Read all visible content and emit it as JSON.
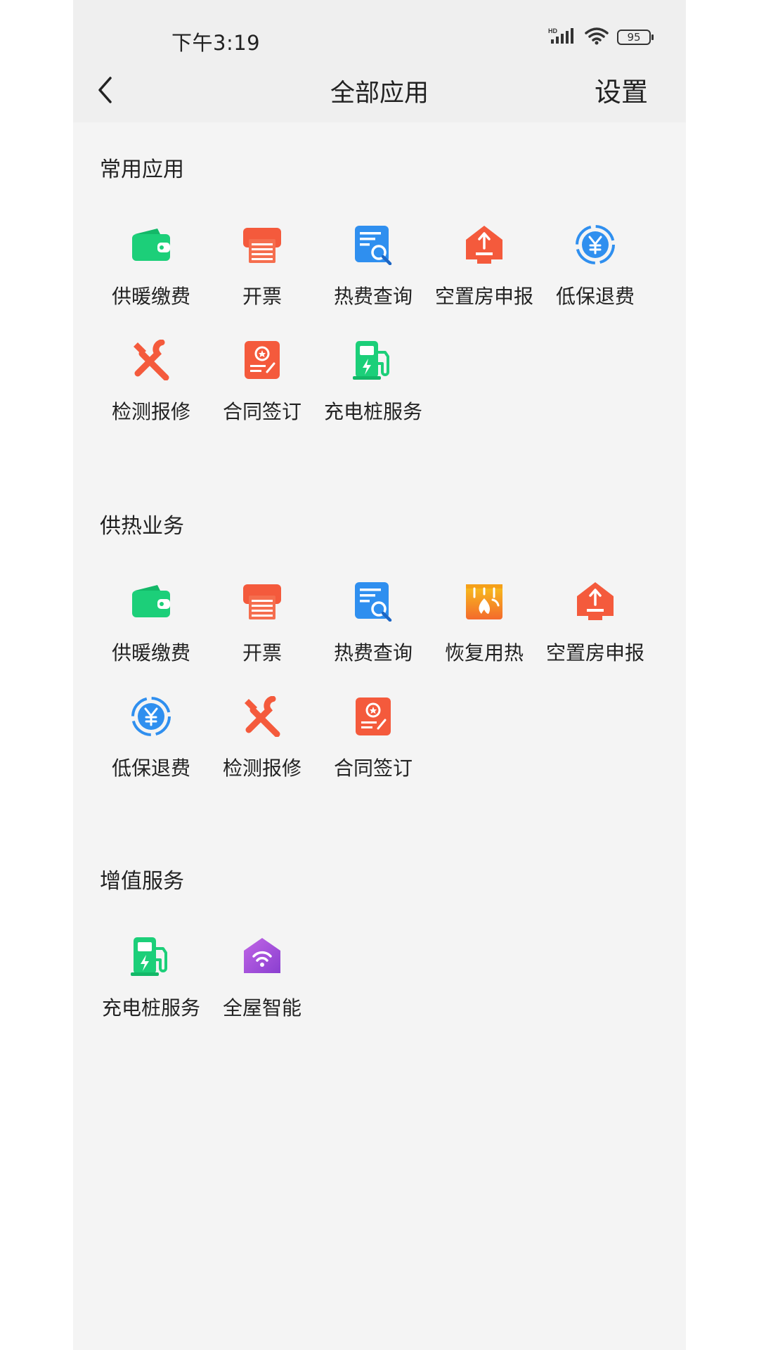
{
  "status_bar": {
    "time": "下午3:19",
    "battery": "95"
  },
  "header": {
    "title": "全部应用",
    "settings_label": "设置"
  },
  "sections": [
    {
      "title": "常用应用",
      "apps": [
        {
          "label": "供暖缴费",
          "icon": "wallet-icon",
          "color": "#1ccf79"
        },
        {
          "label": "开票",
          "icon": "printer-icon",
          "color": "#f45a3c"
        },
        {
          "label": "热费查询",
          "icon": "document-search-icon",
          "color": "#2f8fef"
        },
        {
          "label": "空置房申报",
          "icon": "house-report-icon",
          "color": "#f45a3c"
        },
        {
          "label": "低保退费",
          "icon": "yuan-refund-icon",
          "color": "#2f8fef"
        },
        {
          "label": "检测报修",
          "icon": "repair-tools-icon",
          "color": "#f45a3c"
        },
        {
          "label": "合同签订",
          "icon": "contract-icon",
          "color": "#f45a3c"
        },
        {
          "label": "充电桩服务",
          "icon": "charging-station-icon",
          "color": "#1ccf79"
        }
      ]
    },
    {
      "title": "供热业务",
      "apps": [
        {
          "label": "供暖缴费",
          "icon": "wallet-icon",
          "color": "#1ccf79"
        },
        {
          "label": "开票",
          "icon": "printer-icon",
          "color": "#f45a3c"
        },
        {
          "label": "热费查询",
          "icon": "document-search-icon",
          "color": "#2f8fef"
        },
        {
          "label": "恢复用热",
          "icon": "heating-restore-icon",
          "color": "#f5a018"
        },
        {
          "label": "空置房申报",
          "icon": "house-report-icon",
          "color": "#f45a3c"
        },
        {
          "label": "低保退费",
          "icon": "yuan-refund-icon",
          "color": "#2f8fef"
        },
        {
          "label": "检测报修",
          "icon": "repair-tools-icon",
          "color": "#f45a3c"
        },
        {
          "label": "合同签订",
          "icon": "contract-icon",
          "color": "#f45a3c"
        }
      ]
    },
    {
      "title": "增值服务",
      "apps": [
        {
          "label": "充电桩服务",
          "icon": "charging-station-icon",
          "color": "#1ccf79"
        },
        {
          "label": "全屋智能",
          "icon": "smart-home-icon",
          "color": "#a055d6"
        }
      ]
    }
  ]
}
